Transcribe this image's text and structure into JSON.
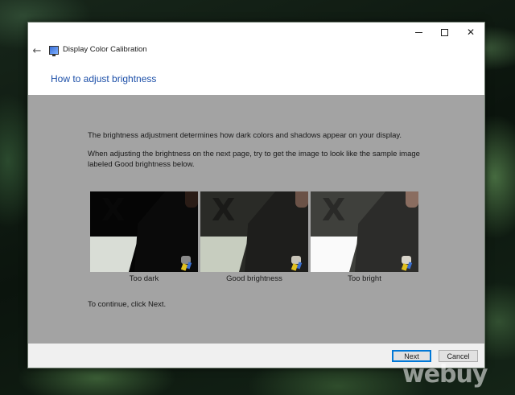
{
  "window": {
    "title": "Display Color Calibration",
    "heading": "How to adjust brightness"
  },
  "titlebar": {
    "minimize_icon": "minimize-icon",
    "maximize_icon": "maximize-icon",
    "close_icon": "close-icon",
    "close_glyph": "✕"
  },
  "nav": {
    "back_icon": "back-arrow-icon",
    "back_glyph": "←"
  },
  "content": {
    "paragraph1": "The brightness adjustment determines how dark colors and shadows appear on your display.",
    "paragraph2": "When adjusting the brightness on the next page, try to get the image to look like the sample image labeled Good brightness below.",
    "samples": [
      {
        "caption": "Too dark"
      },
      {
        "caption": "Good brightness"
      },
      {
        "caption": "Too bright"
      }
    ],
    "continue_text": "To continue, click Next."
  },
  "footer": {
    "next_label": "Next",
    "cancel_label": "Cancel"
  },
  "watermark": "webuy",
  "colors": {
    "heading": "#1c4fa8",
    "content_bg": "#a3a3a3",
    "footer_bg": "#f0f0f0",
    "default_button_border": "#0078d7"
  }
}
